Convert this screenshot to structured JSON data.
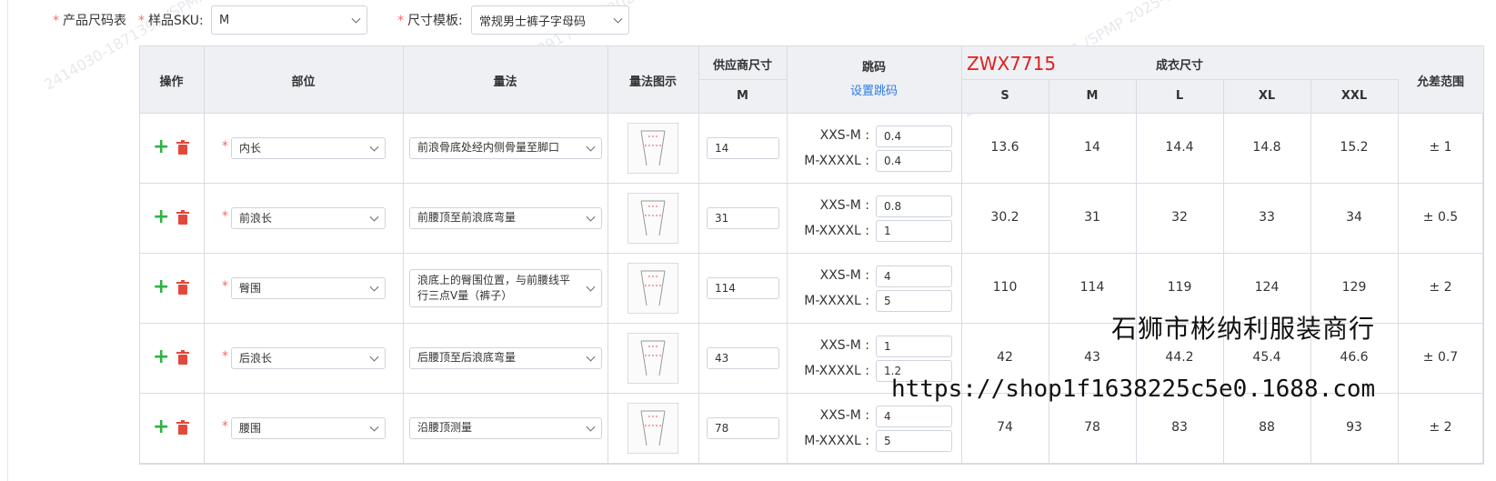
{
  "form": {
    "table_label": "产品尺码表",
    "sku_label": "样品SKU:",
    "sku_value": "M",
    "template_label": "尺寸模板:",
    "template_value": "常规男士裤子字母码"
  },
  "watermarks": [
    "2414030-1871391 /SPMP 2025-01-14",
    "SPMP 2025-01-14"
  ],
  "header": {
    "ops": "操作",
    "part": "部位",
    "method": "量法",
    "diagram": "量法图示",
    "supplier": "供应商尺寸",
    "supplier_size": "M",
    "jump": "跳码",
    "jump_link": "设置跳码",
    "product_code": "ZWX7715",
    "finished": "成衣尺寸",
    "sizes": [
      "S",
      "M",
      "L",
      "XL",
      "XXL"
    ],
    "tolerance": "允差范围"
  },
  "jump_labels": {
    "a": "XXS-M :",
    "b": "M-XXXXL :"
  },
  "rows": [
    {
      "part": "内长",
      "method": "前浪骨底处经内侧骨量至脚口",
      "supplier": "14",
      "jump_a": "0.4",
      "jump_b": "0.4",
      "sizes": [
        "13.6",
        "14",
        "14.4",
        "14.8",
        "15.2"
      ],
      "tolerance": "± 1"
    },
    {
      "part": "前浪长",
      "method": "前腰顶至前浪底弯量",
      "supplier": "31",
      "jump_a": "0.8",
      "jump_b": "1",
      "sizes": [
        "30.2",
        "31",
        "32",
        "33",
        "34"
      ],
      "tolerance": "± 0.5"
    },
    {
      "part": "臀围",
      "method": "浪底上的臀围位置，与前腰线平行三点V量（裤子）",
      "supplier": "114",
      "jump_a": "4",
      "jump_b": "5",
      "sizes": [
        "110",
        "114",
        "119",
        "124",
        "129"
      ],
      "tolerance": "± 2"
    },
    {
      "part": "后浪长",
      "method": "后腰顶至后浪底弯量",
      "supplier": "43",
      "jump_a": "1",
      "jump_b": "1.2",
      "sizes": [
        "42",
        "43",
        "44.2",
        "45.4",
        "46.6"
      ],
      "tolerance": "± 0.7"
    },
    {
      "part": "腰围",
      "method": "沿腰顶测量",
      "supplier": "78",
      "jump_a": "4",
      "jump_b": "5",
      "sizes": [
        "74",
        "78",
        "83",
        "88",
        "93"
      ],
      "tolerance": "± 2"
    }
  ],
  "overlay": {
    "shop_name": "石狮市彬纳利服装商行",
    "url": "https://shop1f1638225c5e0.1688.com"
  }
}
